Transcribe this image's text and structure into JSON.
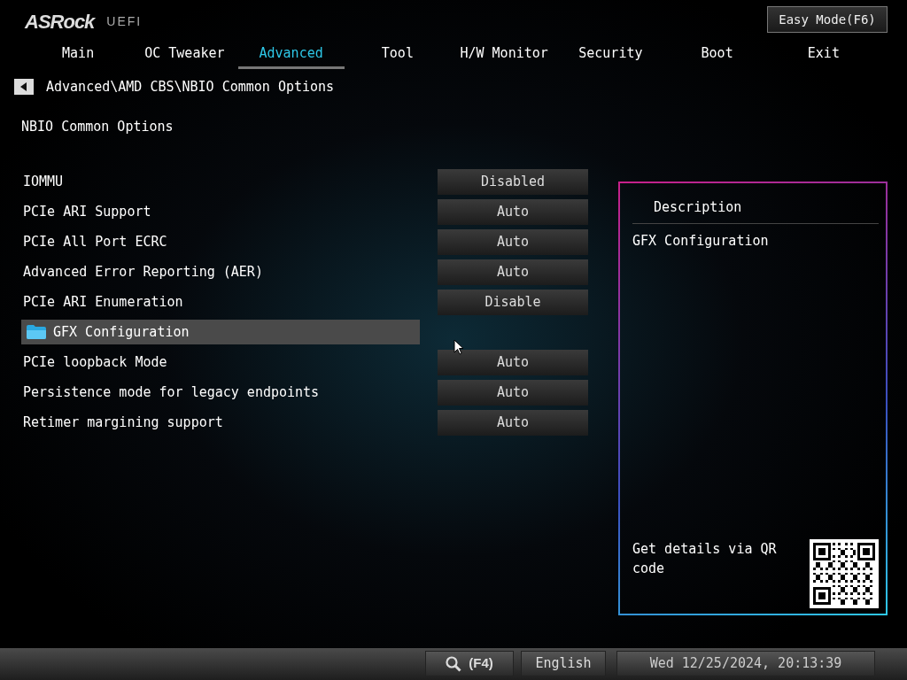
{
  "header": {
    "logo": "ASRock",
    "logo_suffix": "UEFI",
    "easy_mode_button": "Easy Mode(F6)"
  },
  "tabs": [
    {
      "label": "Main",
      "selected": false
    },
    {
      "label": "OC Tweaker",
      "selected": false
    },
    {
      "label": "Advanced",
      "selected": true
    },
    {
      "label": "Tool",
      "selected": false
    },
    {
      "label": "H/W Monitor",
      "selected": false
    },
    {
      "label": "Security",
      "selected": false
    },
    {
      "label": "Boot",
      "selected": false
    },
    {
      "label": "Exit",
      "selected": false
    }
  ],
  "breadcrumb": "Advanced\\AMD CBS\\NBIO Common Options",
  "page_title": "NBIO Common Options",
  "settings": [
    {
      "kind": "option",
      "label": "IOMMU",
      "value": "Disabled",
      "selected": false
    },
    {
      "kind": "option",
      "label": "PCIe ARI Support",
      "value": "Auto",
      "selected": false
    },
    {
      "kind": "option",
      "label": "PCIe All Port ECRC",
      "value": "Auto",
      "selected": false
    },
    {
      "kind": "option",
      "label": "Advanced Error Reporting (AER)",
      "value": "Auto",
      "selected": false
    },
    {
      "kind": "option",
      "label": "PCIe ARI Enumeration",
      "value": "Disable",
      "selected": false
    },
    {
      "kind": "submenu",
      "label": "GFX Configuration",
      "selected": true
    },
    {
      "kind": "option",
      "label": "PCIe loopback Mode",
      "value": "Auto",
      "selected": false
    },
    {
      "kind": "option",
      "label": "Persistence mode for legacy endpoints",
      "value": "Auto",
      "selected": false
    },
    {
      "kind": "option",
      "label": "Retimer margining support",
      "value": "Auto",
      "selected": false
    }
  ],
  "description": {
    "title": "Description",
    "text": "GFX Configuration",
    "qr_text": "Get details via QR code"
  },
  "status_bar": {
    "search_label": "(F4)",
    "language": "English",
    "datetime": "Wed 12/25/2024, 20:13:39"
  }
}
